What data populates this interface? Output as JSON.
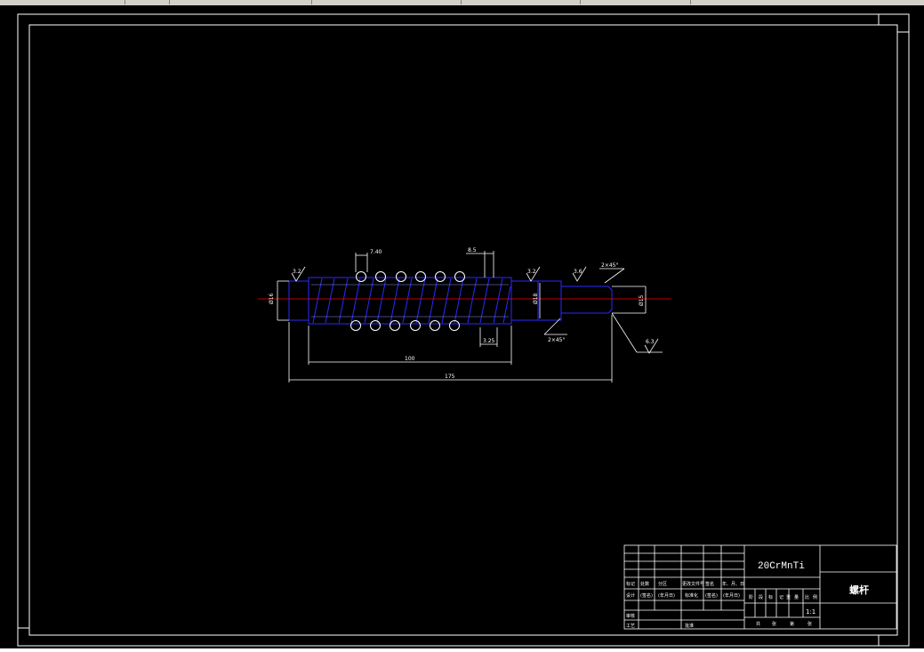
{
  "title_block": {
    "material": "20CrMnTi",
    "part_name": "螺杆",
    "scale": "1:1",
    "row_labels_left": [
      "标记",
      "设计",
      "审核",
      "工艺"
    ],
    "row_labels_mid": [
      "处数",
      "(签名)",
      "分区",
      "(年月日)",
      "更改文件号",
      "标准化",
      "签名",
      "(签名)",
      "年、月、日",
      "(年月日)"
    ],
    "approve_label": "批准",
    "stage_labels": [
      "阶",
      "段",
      "标",
      "记",
      "重",
      "量",
      "比",
      "例"
    ],
    "sheet_labels": [
      "共",
      "张",
      "第",
      "张"
    ]
  },
  "dimensions": {
    "pitch": "7.40",
    "tooth_width": "8.5",
    "depth": "3.25",
    "thread_length": "100",
    "total_length": "175",
    "dia_left": "Ø16",
    "dia_mid": "Ø18",
    "dia_right": "Ø15",
    "chamfer_left": "2×45°",
    "chamfer_right": "2×45°",
    "roughness_1": "3.2",
    "roughness_2": "3.2",
    "roughness_3": "3.6",
    "roughness_4": "6.3"
  }
}
